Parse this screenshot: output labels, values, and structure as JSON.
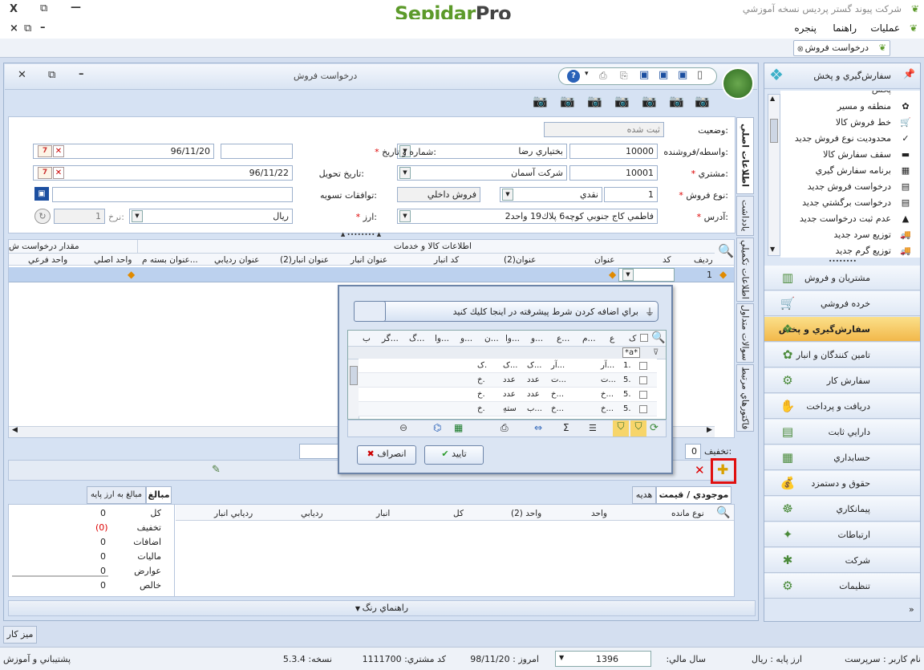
{
  "app": {
    "logo_a": "Sepidar",
    "logo_b": "Pro",
    "window_title": "شرکت پیوند گستر پردیس نسخه آموزشي",
    "minimize": "—",
    "restore": "⧉",
    "close": "X"
  },
  "menu": {
    "items": [
      "عمليات",
      "راهنما",
      "پنجره"
    ]
  },
  "doc_tab": {
    "label": "درخواست فروش"
  },
  "main": {
    "title": "درخواست فروش"
  },
  "form": {
    "status_label": "وضعيت:",
    "status_value": "ثبت شده",
    "agent_label": "واسطه/فروشنده:",
    "agent_code": "10000",
    "agent_name": "بختياري رضا",
    "number_date_label": "شماره و تاريخ:",
    "number_value": "",
    "date_value": "96/11/20",
    "customer_label": "مشتري:",
    "customer_code": "10001",
    "customer_name": "شرکت آسمان",
    "delivery_label": "تاريخ تحويل:",
    "delivery_value": "96/11/22",
    "sale_type_label": "نوع فروش:",
    "sale_type_code": "1",
    "sale_type_name": "نقدي",
    "sale_type_kind": "فروش داخلي",
    "settlement_label": "توافقات تسويه:",
    "settlement_value": "",
    "address_label": "آدرس:",
    "address_value": "فاطمي كاج جنوبي كوچه6 پلاك19 واحد2",
    "currency_label": "ارز:",
    "currency_value": "ريال",
    "rate_label": "نرخ:",
    "rate_value": "1"
  },
  "side_tabs": [
    "اطلاعات اصلي",
    "يادداشت",
    "اطلاعات تكميلي",
    "سوالات متداول",
    "فاكتورهاي مرتبط"
  ],
  "grid": {
    "group_header": "اطلاعات كالا و خدمات",
    "group_header2": "مقدار درخواست ش",
    "columns": [
      "رديف",
      "كد",
      "عنوان",
      "عنوان(2)",
      "كد انبار",
      "عنوان انبار",
      "عنوان انبار(2)",
      "عنوان رديابي",
      "عنوان بسته م...",
      "واحد اصلي",
      "واحد فرعي"
    ],
    "row_number": "1"
  },
  "discount": {
    "label": "تخفيف:",
    "value": "0"
  },
  "dialog": {
    "filter_hint": "براي اضافه كردن شرط پيشرفته در اينجا كليك كنيد",
    "columns": [
      "ک",
      "ع",
      "م...",
      "ع...",
      "و...",
      "وا...",
      "ن...",
      "و...",
      "وا...",
      "گ...",
      "گر...",
      "ب"
    ],
    "filter_cell": "*a*",
    "rows": [
      [
        "1.",
        "آر...",
        "",
        "آر...",
        "ک...",
        "ک...",
        "ک."
      ],
      [
        "5.",
        "ت...",
        "",
        "ت...",
        "عدد",
        "عدد",
        "خ."
      ],
      [
        "5.",
        "خ...",
        "",
        "خ...",
        "عدد",
        "عدد",
        "خ."
      ],
      [
        "5.",
        "خ...",
        "",
        "خ...",
        "ب...",
        "ستهِ",
        "خ."
      ]
    ],
    "ok": "تاييد",
    "cancel": "انصراف"
  },
  "bottom": {
    "tabs": [
      "موجودي / قيمت",
      "هديه"
    ],
    "left_tabs": [
      "مبالغ",
      "مبالغ به ارز پايه"
    ],
    "columns": [
      "نوع مانده",
      "واحد",
      "واحد (2)",
      "كل",
      "انبار",
      "رديابي",
      "رديابي انبار"
    ],
    "summary": [
      {
        "label": "كل",
        "value": "0"
      },
      {
        "label": "تخفيف",
        "value": "(0)"
      },
      {
        "label": "اضافات",
        "value": "0"
      },
      {
        "label": "ماليات",
        "value": "0"
      },
      {
        "label": "عوارض",
        "value": "0"
      },
      {
        "label": "خالص",
        "value": "0"
      }
    ]
  },
  "color_guide": "راهنماي رنگ",
  "desk_tab": "ميز كار",
  "nav": {
    "header": "سفارش‌گيري و پخش",
    "sub_partial": "پخش",
    "sub_items": [
      "منطقه و مسير",
      "خط فروش كالا",
      "محدوديت نوع فروش جديد",
      "سقف سفارش كالا",
      "برنامه سفارش گيري",
      "درخواست فروش جديد",
      "درخواست برگشتي جديد",
      "عدم ثبت درخواست جديد",
      "توزيع سرد جديد",
      "توزيع گرم جديد"
    ],
    "items": [
      "مشتريان و فروش",
      "خرده فروشي",
      "سفارش‌گيري و پخش",
      "تامين كنندگان و انبار",
      "سفارش كار",
      "دريافت و پرداخت",
      "دارايي ثابت",
      "حسابداري",
      "حقوق و دستمزد",
      "پيمانكاري",
      "ارتباطات",
      "شرکت",
      "تنظيمات"
    ],
    "active_index": 2
  },
  "status": {
    "user_label": "نام كاربر :",
    "user_value": "سرپرست",
    "base_currency_label": "ارز پايه :",
    "base_currency_value": "ريال",
    "fiscal_year_label": "سال مالي:",
    "fiscal_year_value": "1396",
    "today_label": "امروز :",
    "today_value": "98/11/20",
    "customer_code_label": "كد مشتري:",
    "customer_code_value": "1111700",
    "version_label": "نسخه:",
    "version_value": "5.3.4",
    "support": "پشتيباني و آموزش"
  },
  "colors": {
    "accent": "#f7d56a",
    "brand_green": "#5c9a2a",
    "highlight_red": "#e01010"
  }
}
